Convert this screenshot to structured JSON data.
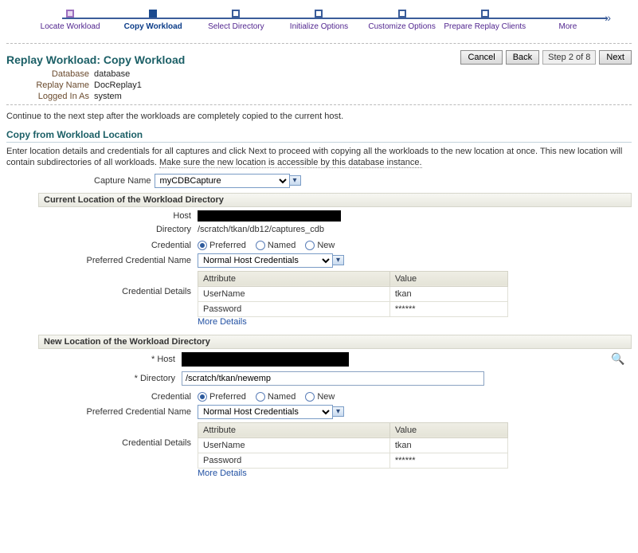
{
  "wizard": {
    "steps": [
      "Locate Workload",
      "Copy Workload",
      "Select Directory",
      "Initialize Options",
      "Customize Options",
      "Prepare Replay Clients",
      "More"
    ]
  },
  "page_title": "Replay Workload: Copy Workload",
  "meta": {
    "database_label": "Database",
    "database_value": "database",
    "replay_name_label": "Replay Name",
    "replay_name_value": "DocReplay1",
    "logged_in_as_label": "Logged In As",
    "logged_in_as_value": "system"
  },
  "buttons": {
    "cancel": "Cancel",
    "back": "Back",
    "next": "Next"
  },
  "step_indicator": "Step 2 of 8",
  "instruction": "Continue to the next step after the workloads are completely copied to the current host.",
  "copy_section": {
    "title": "Copy from Workload Location",
    "desc_a": "Enter location details and credentials for all captures and click Next to proceed with copying all the workloads to the new location at once. This new location will contain subdirectories of all workloads. ",
    "desc_b": "Make sure the new location is accessible by this database instance.",
    "capture_label": "Capture Name",
    "capture_value": "myCDBCapture"
  },
  "current_loc": {
    "title": "Current Location of the Workload Directory",
    "host_label": "Host",
    "directory_label": "Directory",
    "directory_value": "/scratch/tkan/db12/captures_cdb"
  },
  "cred": {
    "label": "Credential",
    "opt_preferred": "Preferred",
    "opt_named": "Named",
    "opt_new": "New",
    "pref_name_label": "Preferred Credential Name",
    "pref_name_value": "Normal Host Credentials",
    "details_label": "Credential Details",
    "col_attr": "Attribute",
    "col_val": "Value",
    "row_user_attr": "UserName",
    "row_user_val": "tkan",
    "row_pass_attr": "Password",
    "row_pass_val": "******",
    "more_details": "More Details"
  },
  "new_loc": {
    "title": "New Location of the Workload Directory",
    "host_label": "* Host",
    "directory_label": "* Directory",
    "directory_value": "/scratch/tkan/newemp"
  }
}
